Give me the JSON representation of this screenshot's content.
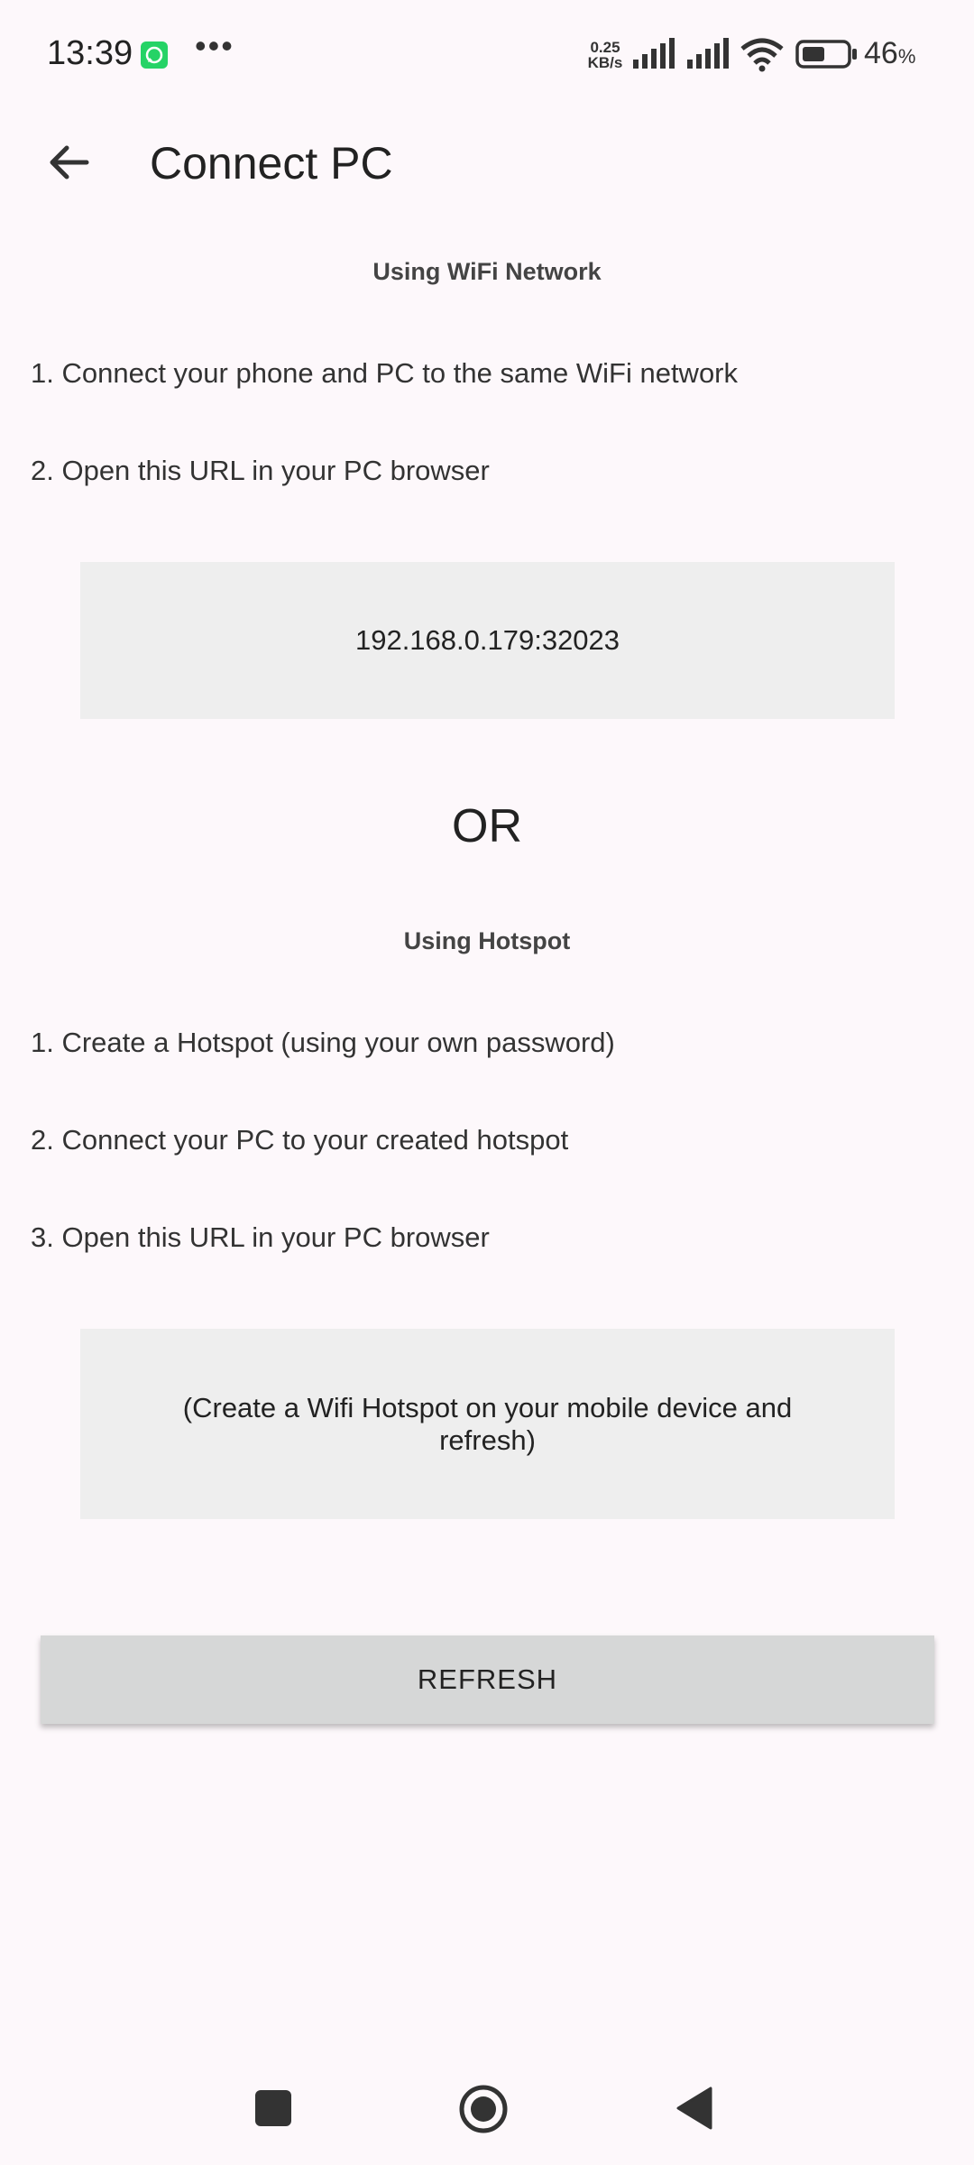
{
  "status_bar": {
    "time": "13:39",
    "net_speed_value": "0.25",
    "net_speed_unit": "KB/s",
    "battery_value": "46",
    "battery_unit": "%",
    "icons": [
      "whatsapp-icon",
      "more-dots-icon",
      "signal-icon",
      "signal-icon",
      "wifi-icon",
      "battery-icon"
    ]
  },
  "app_bar": {
    "title": "Connect PC",
    "back_icon": "arrow-left-icon"
  },
  "wifi_section": {
    "heading": "Using WiFi Network",
    "steps": [
      "1. Connect your phone and PC to the same WiFi network",
      "2. Open this URL in your PC browser"
    ],
    "url": "192.168.0.179:32023"
  },
  "or_label": "OR",
  "hotspot_section": {
    "heading": "Using Hotspot",
    "steps": [
      "1. Create a Hotspot (using your own password)",
      "2. Connect your PC to your created hotspot",
      "3. Open this URL in your PC browser"
    ],
    "url": "(Create a Wifi Hotspot on your mobile device and refresh)"
  },
  "refresh_label": "REFRESH",
  "nav_bar": {
    "icons": [
      "recents-square-icon",
      "home-circle-icon",
      "back-triangle-icon"
    ]
  },
  "colors": {
    "background": "#fdf8fb",
    "url_box": "#eeeeee",
    "button": "#d6d7d7",
    "whatsapp": "#25d366"
  }
}
